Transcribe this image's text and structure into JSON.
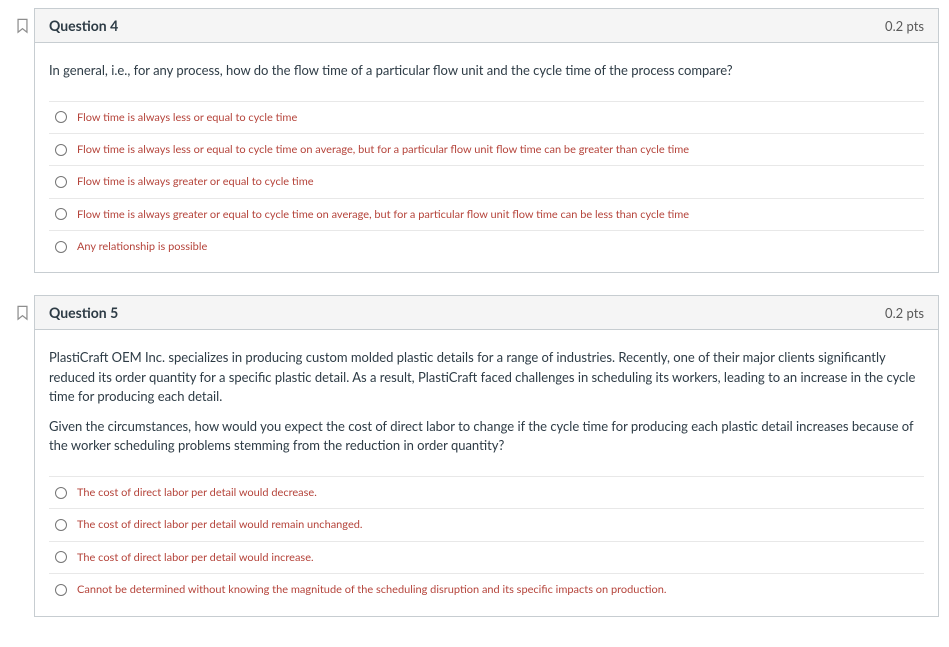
{
  "questions": [
    {
      "title": "Question 4",
      "points": "0.2 pts",
      "prompt_paragraphs": [
        "In general, i.e., for any process, how do the flow time of a particular flow unit and the cycle time of the process compare?"
      ],
      "answers": [
        "Flow time is always less or equal to cycle time",
        "Flow time is always less or equal to cycle time on average, but for a particular flow unit flow time can be greater than cycle time",
        "Flow time is always greater or equal to cycle time",
        "Flow time is always greater or equal to cycle time on average, but for a particular flow unit flow time can be less than cycle time",
        "Any relationship is possible"
      ]
    },
    {
      "title": "Question 5",
      "points": "0.2 pts",
      "prompt_paragraphs": [
        "PlastiCraft OEM Inc. specializes in producing custom molded plastic details for a range of industries. Recently, one of their major clients significantly reduced its order quantity for a specific plastic detail. As a result, PlastiCraft faced challenges in scheduling its workers, leading to an increase in the cycle time for producing each detail.",
        "Given the circumstances, how would you expect the cost of direct labor to change if the cycle time for producing each plastic detail increases because of the worker scheduling problems stemming from the reduction in order quantity?"
      ],
      "answers": [
        "The cost of direct labor per detail would decrease.",
        "The cost of direct labor per detail would remain unchanged.",
        "The cost of direct labor per detail would increase.",
        "Cannot be determined without knowing the magnitude of the scheduling disruption and its specific impacts on production."
      ]
    }
  ]
}
